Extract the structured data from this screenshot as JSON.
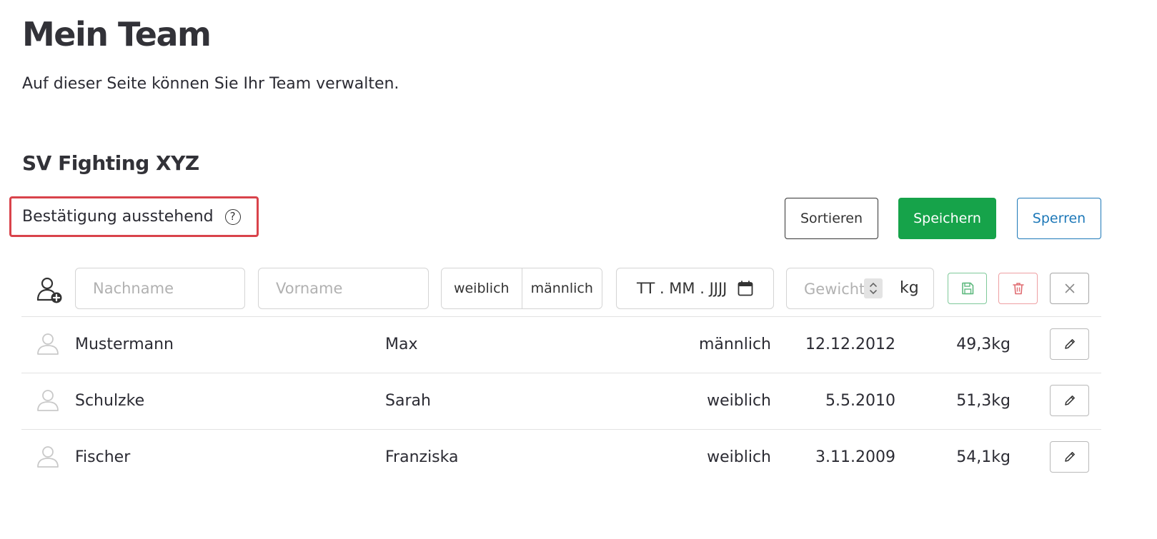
{
  "page": {
    "title": "Mein Team",
    "subtitle": "Auf dieser Seite können Sie Ihr Team verwalten."
  },
  "team": {
    "name": "SV Fighting XYZ",
    "status": "Bestätigung ausstehend"
  },
  "toolbar": {
    "sort_label": "Sortieren",
    "save_label": "Speichern",
    "lock_label": "Sperren"
  },
  "new_member": {
    "lastname_placeholder": "Nachname",
    "firstname_placeholder": "Vorname",
    "gender_options": [
      "weiblich",
      "männlich"
    ],
    "date_placeholder": "TT . MM . JJJJ",
    "weight_placeholder": "Gewicht",
    "weight_unit": "kg"
  },
  "members": [
    {
      "lastname": "Mustermann",
      "firstname": "Max",
      "gender": "männlich",
      "birthdate": "12.12.2012",
      "weight": "49,3kg"
    },
    {
      "lastname": "Schulzke",
      "firstname": "Sarah",
      "gender": "weiblich",
      "birthdate": "5.5.2010",
      "weight": "51,3kg"
    },
    {
      "lastname": "Fischer",
      "firstname": "Franziska",
      "gender": "weiblich",
      "birthdate": "3.11.2009",
      "weight": "54,1kg"
    }
  ],
  "colors": {
    "primary_green": "#16a34a",
    "link_blue": "#1d78b8",
    "highlight_red": "#d9434b",
    "border_gray": "#d4d4d4"
  },
  "icons": {
    "add_member": "user-plus-icon",
    "member": "user-icon",
    "help": "question-circle-icon",
    "date": "calendar-icon",
    "save_row": "floppy-disk-icon",
    "delete_row": "trash-icon",
    "cancel_row": "close-icon",
    "edit_row": "pencil-icon"
  }
}
